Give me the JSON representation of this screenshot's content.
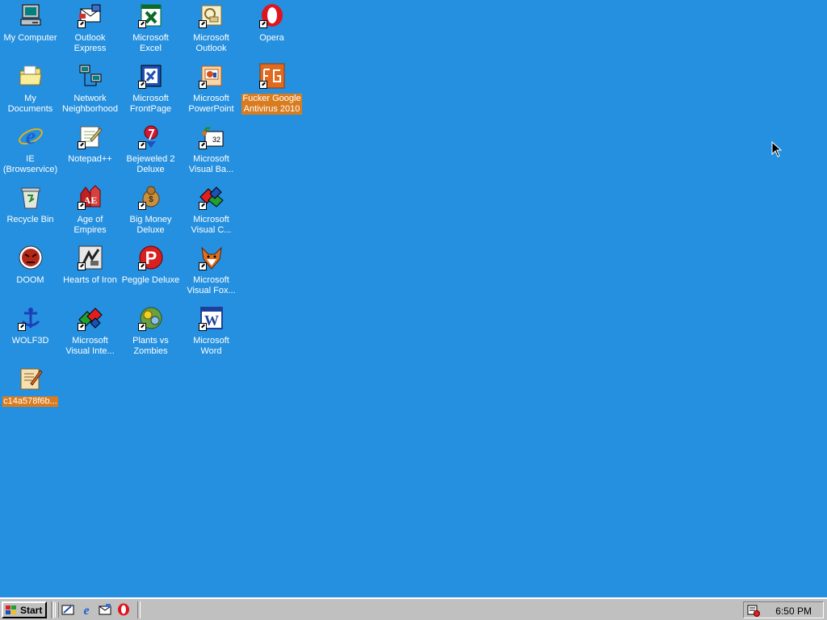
{
  "desktop": {
    "icons": [
      {
        "label": "My Computer",
        "icon": "computer-icon"
      },
      {
        "label": "Outlook\nExpress",
        "icon": "outlook-express-icon"
      },
      {
        "label": "Microsoft\nExcel",
        "icon": "excel-icon"
      },
      {
        "label": "Microsoft\nOutlook",
        "icon": "outlook-icon"
      },
      {
        "label": "Opera",
        "icon": "opera-icon"
      },
      {
        "label": "My Documents",
        "icon": "documents-folder-icon"
      },
      {
        "label": "Network\nNeighborhood",
        "icon": "network-icon"
      },
      {
        "label": "Microsoft\nFrontPage",
        "icon": "frontpage-icon"
      },
      {
        "label": "Microsoft\nPowerPoint",
        "icon": "powerpoint-icon"
      },
      {
        "label": "Fucker Google\nAntivirus 2010",
        "icon": "antivirus-icon",
        "selected": true
      },
      {
        "label": "IE\n(Browservice)",
        "icon": "internet-explorer-icon"
      },
      {
        "label": "Notepad++",
        "icon": "notepad-icon"
      },
      {
        "label": "Bejeweled 2\nDeluxe",
        "icon": "bejeweled-icon"
      },
      {
        "label": "Microsoft\nVisual Ba...",
        "icon": "visual-basic-icon"
      },
      {
        "label": "Recycle Bin",
        "icon": "recycle-bin-icon"
      },
      {
        "label": "Age of\nEmpires",
        "icon": "age-of-empires-icon"
      },
      {
        "label": "Big Money\nDeluxe",
        "icon": "big-money-icon"
      },
      {
        "label": "Microsoft\nVisual C...",
        "icon": "visual-c-icon"
      },
      {
        "label": "DOOM",
        "icon": "doom-icon"
      },
      {
        "label": "Hearts of Iron",
        "icon": "hearts-of-iron-icon"
      },
      {
        "label": "Peggle Deluxe",
        "icon": "peggle-icon"
      },
      {
        "label": "Microsoft\nVisual Fox...",
        "icon": "visual-foxpro-icon"
      },
      {
        "label": "WOLF3D",
        "icon": "wolf3d-icon"
      },
      {
        "label": "Microsoft\nVisual Inte...",
        "icon": "visual-interdev-icon"
      },
      {
        "label": "Plants vs\nZombies",
        "icon": "plants-vs-zombies-icon"
      },
      {
        "label": "Microsoft\nWord",
        "icon": "word-icon"
      },
      {
        "label": "c14a578f6b...",
        "icon": "script-file-icon",
        "selected": true
      }
    ]
  },
  "taskbar": {
    "start_label": "Start",
    "quick_launch": [
      "show-desktop-icon",
      "internet-explorer-icon",
      "outlook-express-icon",
      "opera-icon"
    ],
    "tray_icon": "scheduler-icon",
    "clock": "6:50 PM"
  },
  "colors": {
    "desktop_background": "#2590df",
    "selection": "#d97c1f",
    "taskbar": "#c0c0c0"
  }
}
